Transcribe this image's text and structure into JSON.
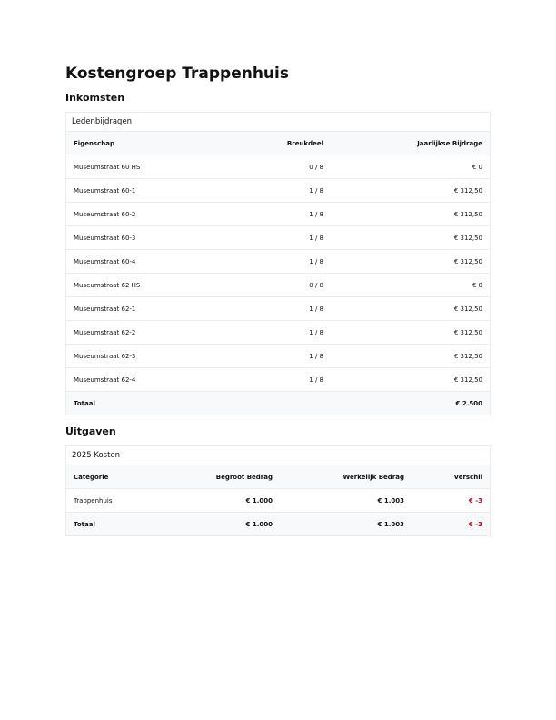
{
  "title": "Kostengroep Trappenhuis",
  "inkomsten": {
    "heading": "Inkomsten",
    "card_title": "Ledenbijdragen",
    "headers": [
      "Eigenschap",
      "Breukdeel",
      "Jaarlijkse Bijdrage"
    ],
    "rows": [
      [
        "Museumstraat 60 HS",
        "0 / 8",
        "€ 0"
      ],
      [
        "Museumstraat 60-1",
        "1 / 8",
        "€ 312,50"
      ],
      [
        "Museumstraat 60-2",
        "1 / 8",
        "€ 312,50"
      ],
      [
        "Museumstraat 60-3",
        "1 / 8",
        "€ 312,50"
      ],
      [
        "Museumstraat 60-4",
        "1 / 8",
        "€ 312,50"
      ],
      [
        "Museumstraat 62 HS",
        "0 / 8",
        "€ 0"
      ],
      [
        "Museumstraat 62-1",
        "1 / 8",
        "€ 312,50"
      ],
      [
        "Museumstraat 62-2",
        "1 / 8",
        "€ 312,50"
      ],
      [
        "Museumstraat 62-3",
        "1 / 8",
        "€ 312,50"
      ],
      [
        "Museumstraat 62-4",
        "1 / 8",
        "€ 312,50"
      ]
    ],
    "total_label": "Totaal",
    "total_value": "€ 2.500"
  },
  "uitgaven": {
    "heading": "Uitgaven",
    "card_title": "2025 Kosten",
    "headers": [
      "Categorie",
      "Begroot Bedrag",
      "Werkelijk Bedrag",
      "Verschil"
    ],
    "rows": [
      [
        "Trappenhuis",
        "€ 1.000",
        "€ 1.003",
        "€ -3"
      ]
    ],
    "total": [
      "Totaal",
      "€ 1.000",
      "€ 1.003",
      "€ -3"
    ]
  },
  "colors": {
    "negative": "#b0102a",
    "header_bg": "#f8f9fb",
    "border": "#ececec"
  }
}
